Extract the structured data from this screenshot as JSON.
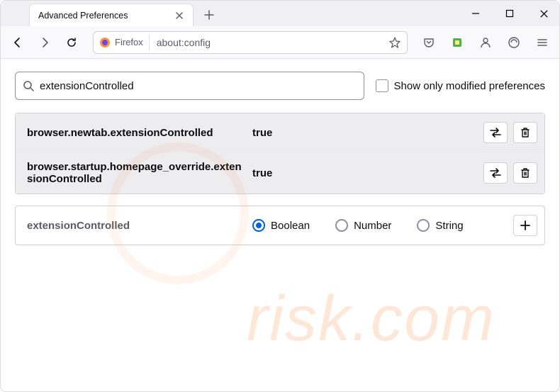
{
  "titlebar": {
    "tab_title": "Advanced Preferences"
  },
  "toolbar": {
    "firefox_label": "Firefox",
    "url": "about:config"
  },
  "search": {
    "value": "extensionControlled",
    "checkbox_label": "Show only modified preferences"
  },
  "prefs": [
    {
      "name": "browser.newtab.extensionControlled",
      "value": "true"
    },
    {
      "name": "browser.startup.homepage_override.extensionControlled",
      "value": "true"
    }
  ],
  "new_pref": {
    "name": "extensionControlled",
    "types": {
      "boolean": "Boolean",
      "number": "Number",
      "string": "String"
    }
  }
}
